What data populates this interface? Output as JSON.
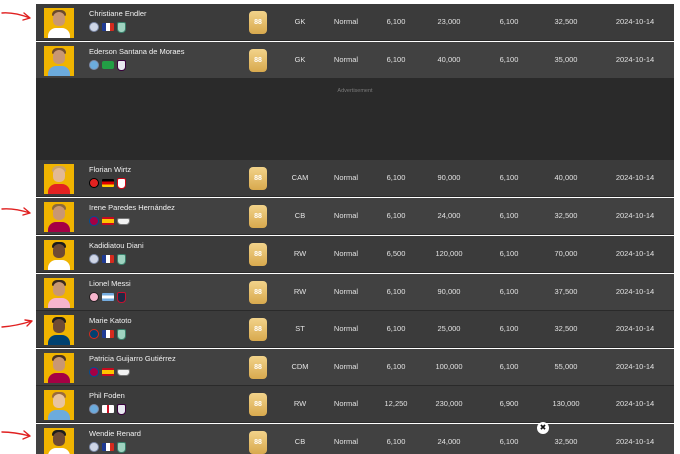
{
  "advertisement_label": "Advertisement",
  "close_symbol": "✖",
  "colors": {
    "row_bg": "#3b3b3b",
    "ad_bg": "#2a2a2a",
    "avatar_bg": "#f0b400",
    "rating_gold": "#d8a94e",
    "annotation_red": "#e02020"
  },
  "players": [
    {
      "name": "Christiane Endler",
      "rating": "88",
      "position": "GK",
      "version": "Normal",
      "p1": "6,100",
      "p2": "23,000",
      "p3": "6,100",
      "p4": "32,500",
      "date": "2024-10-14"
    },
    {
      "name": "Ederson Santana de Moraes",
      "rating": "88",
      "position": "GK",
      "version": "Normal",
      "p1": "6,100",
      "p2": "40,000",
      "p3": "6,100",
      "p4": "35,000",
      "date": "2024-10-14"
    },
    {
      "name": "Florian Wirtz",
      "rating": "88",
      "position": "CAM",
      "version": "Normal",
      "p1": "6,100",
      "p2": "90,000",
      "p3": "6,100",
      "p4": "40,000",
      "date": "2024-10-14"
    },
    {
      "name": "Irene Paredes Hernández",
      "rating": "88",
      "position": "CB",
      "version": "Normal",
      "p1": "6,100",
      "p2": "24,000",
      "p3": "6,100",
      "p4": "32,500",
      "date": "2024-10-14"
    },
    {
      "name": "Kadidiatou Diani",
      "rating": "88",
      "position": "RW",
      "version": "Normal",
      "p1": "6,500",
      "p2": "120,000",
      "p3": "6,100",
      "p4": "70,000",
      "date": "2024-10-14"
    },
    {
      "name": "Lionel Messi",
      "rating": "88",
      "position": "RW",
      "version": "Normal",
      "p1": "6,100",
      "p2": "90,000",
      "p3": "6,100",
      "p4": "37,500",
      "date": "2024-10-14"
    },
    {
      "name": "Marie Katoto",
      "rating": "88",
      "position": "ST",
      "version": "Normal",
      "p1": "6,100",
      "p2": "25,000",
      "p3": "6,100",
      "p4": "32,500",
      "date": "2024-10-14"
    },
    {
      "name": "Patricia Guijarro Gutiérrez",
      "rating": "88",
      "position": "CDM",
      "version": "Normal",
      "p1": "6,100",
      "p2": "100,000",
      "p3": "6,100",
      "p4": "55,000",
      "date": "2024-10-14"
    },
    {
      "name": "Phil Foden",
      "rating": "88",
      "position": "RW",
      "version": "Normal",
      "p1": "12,250",
      "p2": "230,000",
      "p3": "6,900",
      "p4": "130,000",
      "date": "2024-10-14"
    },
    {
      "name": "Wendie Renard",
      "rating": "88",
      "position": "CB",
      "version": "Normal",
      "p1": "6,100",
      "p2": "24,000",
      "p3": "6,100",
      "p4": "32,500",
      "date": "2024-10-14"
    }
  ]
}
